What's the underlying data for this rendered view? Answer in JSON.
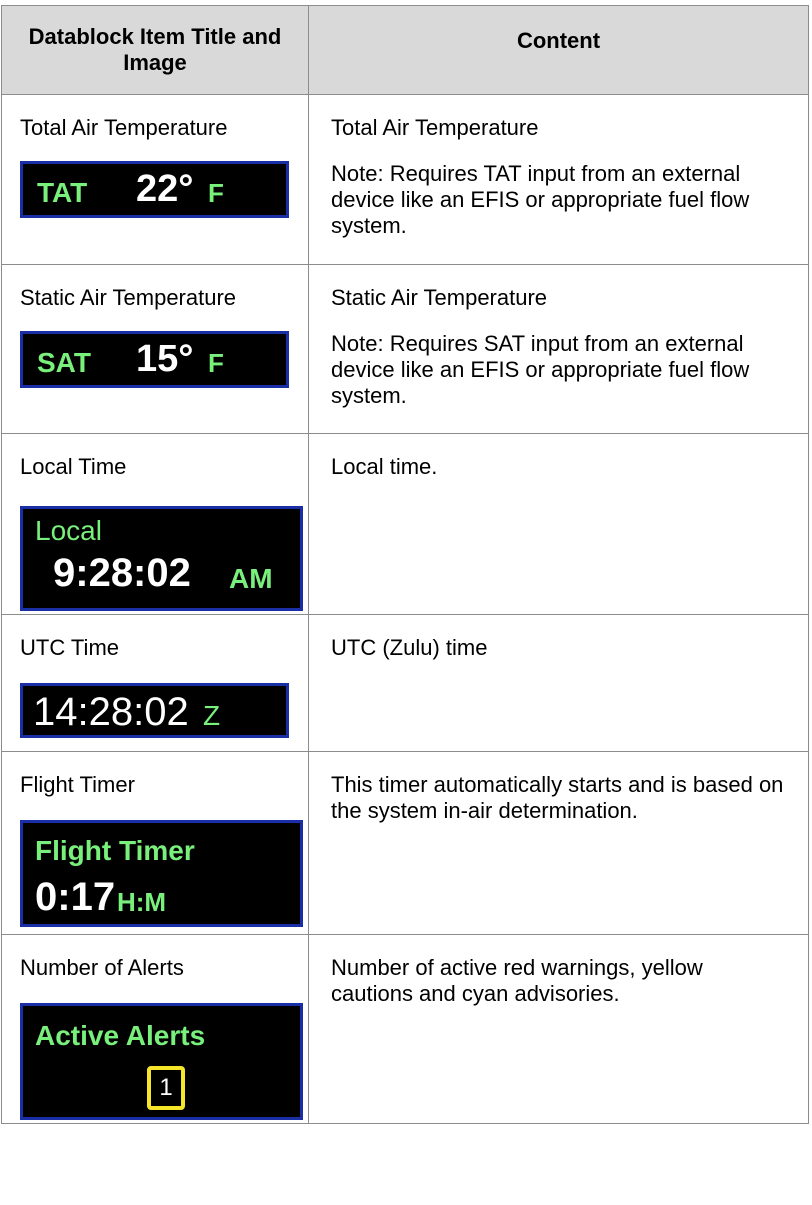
{
  "header": {
    "col1": "Datablock Item Title and Image",
    "col2": "Content"
  },
  "rows": [
    {
      "title": "Total Air Temperature",
      "content": [
        "Total Air Temperature",
        "Note:  Requires TAT input from an external device like an EFIS or appropriate fuel flow system."
      ],
      "display": {
        "label": "TAT",
        "value": "22°",
        "unit": "F"
      }
    },
    {
      "title": "Static Air Temperature",
      "content": [
        "Static Air Temperature",
        "Note:  Requires SAT input from an external device like an EFIS or appropriate fuel flow system."
      ],
      "display": {
        "label": "SAT",
        "value": "15°",
        "unit": "F"
      }
    },
    {
      "title": "Local Time",
      "content": [
        "Local time."
      ],
      "display": {
        "label": "Local",
        "value": "9:28:02",
        "unit": "AM"
      }
    },
    {
      "title": "UTC Time",
      "content": [
        "UTC (Zulu) time"
      ],
      "display": {
        "value": "14:28:02",
        "unit": "Z"
      }
    },
    {
      "title": "Flight Timer",
      "content": [
        "This timer automatically starts and is based on the system in-air determination."
      ],
      "display": {
        "label": "Flight Timer",
        "value": "0:17",
        "unit": "H:M"
      }
    },
    {
      "title": "Number of Alerts",
      "content": [
        "Number of active red warnings, yellow cautions and cyan advisories."
      ],
      "display": {
        "label": "Active Alerts",
        "value": "1"
      }
    }
  ],
  "colors": {
    "display_bg": "#000000",
    "display_border": "#1a2ea6",
    "label_green": "#79f07b",
    "value_white": "#ffffff",
    "alert_yellow": "#f5e62a",
    "header_bg": "#d9d9d9"
  }
}
